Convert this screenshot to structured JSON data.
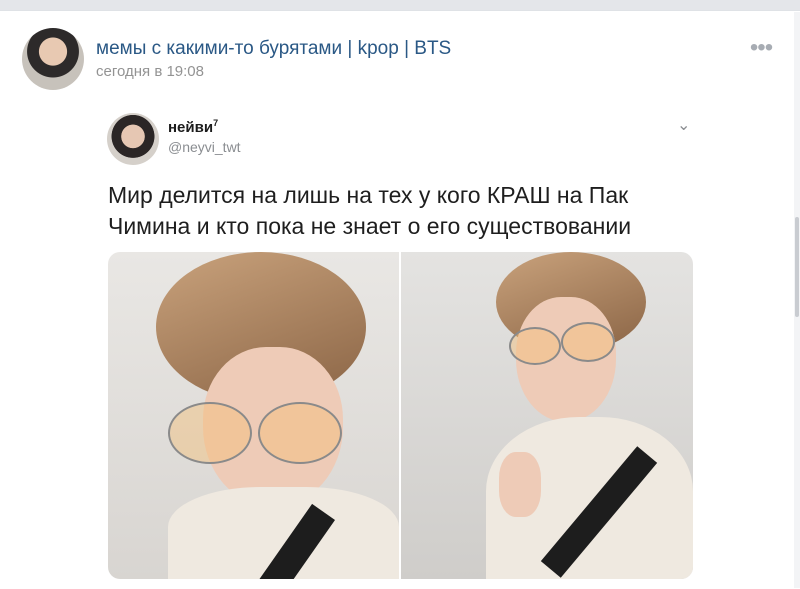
{
  "post": {
    "title": "мемы с какими-то бурятами | kpop | BTS",
    "time": "сегодня в 19:08",
    "more_icon": "•••"
  },
  "tweet": {
    "name": "нейви",
    "name_sup": "7",
    "handle": "@neyvi_twt",
    "chevron": "⌄",
    "text": "Мир делится на лишь на тех у кого КРАШ на Пак Чимина и кто пока не знает о его существовании"
  },
  "colors": {
    "link": "#2a5885",
    "muted": "#939393",
    "background": "#edeef0"
  }
}
